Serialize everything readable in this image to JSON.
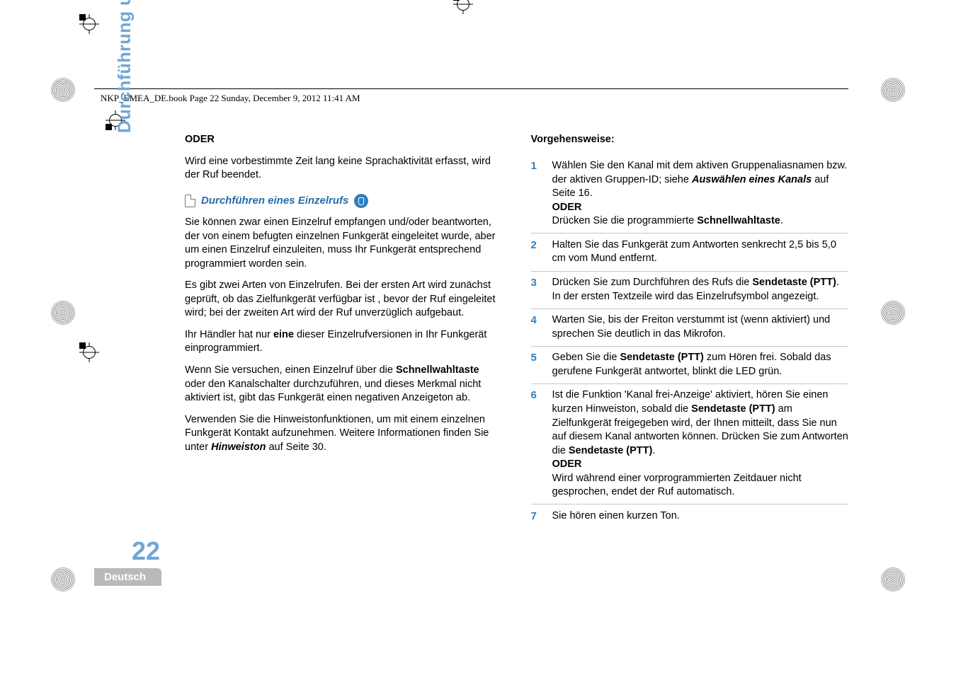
{
  "header": "NKP_EMEA_DE.book  Page 22  Sunday, December 9, 2012  11:41 AM",
  "side_title": "Durchführung und Empfang von Rufen",
  "page_number": "22",
  "lang": "Deutsch",
  "left": {
    "oder1": "ODER",
    "p1": "Wird eine vorbestimmte Zeit lang keine Sprachaktivität erfasst, wird der Ruf beendet.",
    "section_title": "Durchführen eines Einzelrufs",
    "p2": "Sie können zwar einen Einzelruf empfangen und/oder beantworten, der von einem befugten einzelnen Funkgerät eingeleitet wurde, aber um einen Einzelruf einzuleiten, muss Ihr Funkgerät entsprechend programmiert worden sein.",
    "p3": "Es gibt zwei Arten von Einzelrufen. Bei der ersten Art wird zunächst geprüft, ob das Zielfunkgerät verfügbar ist , bevor der Ruf eingeleitet wird; bei der zweiten Art wird der Ruf unverzüglich aufgebaut.",
    "p4a": "Ihr Händler hat nur ",
    "p4b": "eine",
    "p4c": " dieser Einzelrufversionen in Ihr Funkgerät einprogrammiert.",
    "p5a": "Wenn Sie versuchen, einen Einzelruf über die ",
    "p5b": "Schnellwahltaste",
    "p5c": " oder den Kanalschalter durchzuführen, und dieses Merkmal nicht aktiviert ist, gibt das Funkgerät einen negativen Anzeigeton ab.",
    "p6a": "Verwenden Sie die Hinweistonfunktionen, um mit einem einzelnen Funkgerät Kontakt aufzunehmen. Weitere Informationen finden Sie unter ",
    "p6b": "Hinweiston",
    "p6c": " auf Seite 30."
  },
  "right": {
    "vorg": "Vorgehensweise:",
    "steps": [
      {
        "n": "1",
        "a": "Wählen Sie den Kanal mit dem aktiven Gruppenaliasnamen bzw. der aktiven Gruppen-ID; siehe ",
        "b": "Auswählen eines Kanals",
        "c": " auf Seite 16.",
        "oder": "ODER",
        "d": "Drücken Sie die programmierte ",
        "e": "Schnellwahltaste",
        "f": "."
      },
      {
        "n": "2",
        "a": "Halten Sie das Funkgerät zum Antworten senkrecht 2,5 bis 5,0 cm vom Mund entfernt."
      },
      {
        "n": "3",
        "a": "Drücken Sie zum Durchführen des Rufs die ",
        "b": "Sendetaste (PTT)",
        "c": ". In der ersten Textzeile wird das Einzelrufsymbol angezeigt."
      },
      {
        "n": "4",
        "a": "Warten Sie, bis der Freiton verstummt ist (wenn aktiviert) und sprechen Sie deutlich in das Mikrofon."
      },
      {
        "n": "5",
        "a": "Geben Sie die ",
        "b": "Sendetaste (PTT)",
        "c": " zum Hören frei. Sobald das gerufene Funkgerät antwortet, blinkt die LED grün."
      },
      {
        "n": "6",
        "a": "Ist die Funktion 'Kanal frei-Anzeige' aktiviert, hören Sie einen kurzen Hinweiston, sobald die ",
        "b": "Sendetaste (PTT)",
        "c": " am Zielfunkgerät freigegeben wird, der Ihnen mitteilt, dass Sie nun auf diesem Kanal antworten können. Drücken Sie zum Antworten die ",
        "d": "Sendetaste (PTT)",
        "e": ".",
        "oder": "ODER",
        "f": "Wird während einer vorprogrammierten Zeitdauer nicht gesprochen, endet der Ruf automatisch."
      },
      {
        "n": "7",
        "a": "Sie hören einen kurzen Ton."
      }
    ]
  }
}
